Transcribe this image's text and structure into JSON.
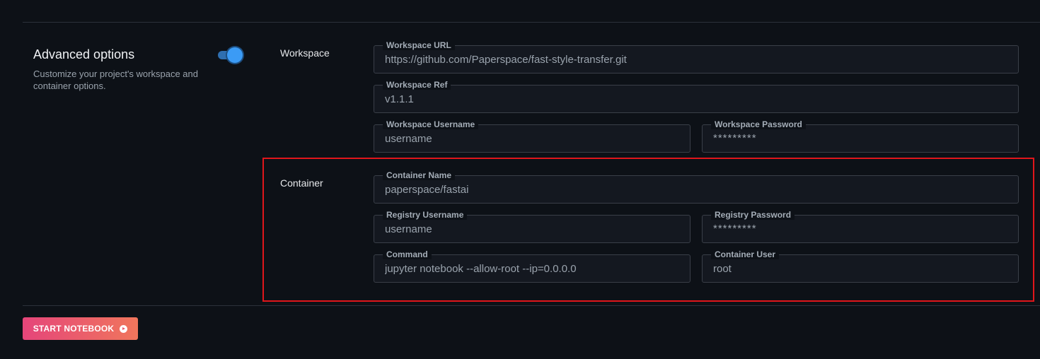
{
  "advanced": {
    "title": "Advanced options",
    "description": "Customize your project's workspace and container options.",
    "toggle_on": true
  },
  "workspace": {
    "label": "Workspace",
    "url": {
      "label": "Workspace URL",
      "value": "https://github.com/Paperspace/fast-style-transfer.git"
    },
    "ref": {
      "label": "Workspace Ref",
      "value": "v1.1.1"
    },
    "username": {
      "label": "Workspace Username",
      "placeholder": "username"
    },
    "password": {
      "label": "Workspace Password",
      "placeholder": "*********"
    }
  },
  "container": {
    "label": "Container",
    "name": {
      "label": "Container Name",
      "value": "paperspace/fastai"
    },
    "registry_username": {
      "label": "Registry Username",
      "placeholder": "username"
    },
    "registry_password": {
      "label": "Registry Password",
      "placeholder": "*********"
    },
    "command": {
      "label": "Command",
      "value": "jupyter notebook --allow-root --ip=0.0.0.0"
    },
    "user": {
      "label": "Container User",
      "value": "root"
    }
  },
  "actions": {
    "start_label": "START NOTEBOOK"
  },
  "colors": {
    "background": "#0d1117",
    "toggle_accent": "#3b9bf5",
    "highlight_border": "#e0161b",
    "button_gradient_start": "#e5457a",
    "button_gradient_end": "#f0765c"
  }
}
